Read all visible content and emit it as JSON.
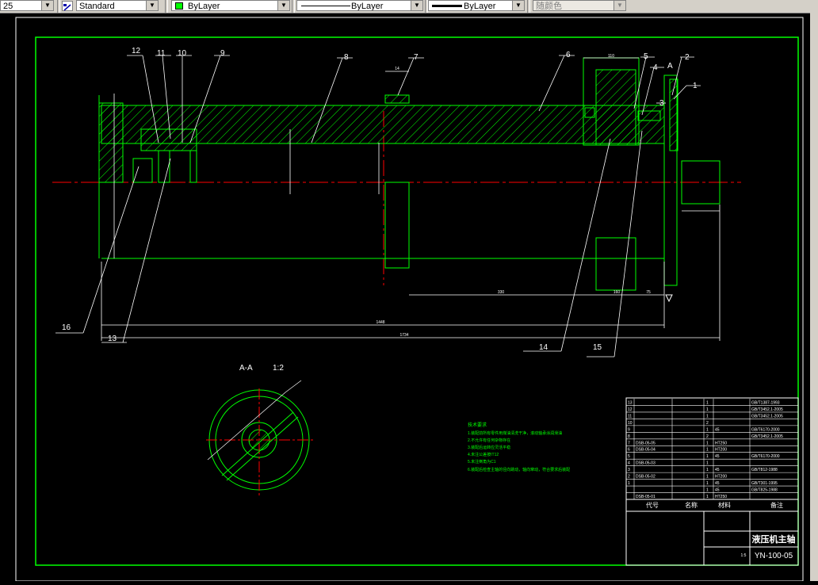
{
  "toolbar": {
    "scale_value": "25",
    "style_icon": "text-style-icon",
    "text_style": "Standard",
    "layer_color": "ByLayer",
    "layer_color_hex": "#00ff00",
    "linetype": "ByLayer",
    "lineweight": "ByLayer",
    "plot_style": "随颜色"
  },
  "drawing": {
    "part_balloons": [
      "1",
      "2",
      "3",
      "4",
      "5",
      "6",
      "7",
      "8",
      "9",
      "10",
      "11",
      "12",
      "13",
      "14",
      "15",
      "16"
    ],
    "section_marker": "A",
    "section_view_label": "A-A",
    "section_view_scale": "1:2",
    "dims": {
      "keyway_width": "14",
      "overall_length": "1734",
      "shaft_length": "1448",
      "right_offset": "75",
      "main_span": "330",
      "short_span": "160",
      "small_span": "110"
    },
    "notes_title": "技术要求",
    "notes": [
      "1.装配前所有零件用煤油清洗干净，滚动轴承涂润滑油",
      "2.不允许有任何杂物存在",
      "3.装配后运转应灵活平稳",
      "4.未注公差按IT12",
      "5.未注倒角为C1",
      "6.装配后检查主轴的径向跳动，轴向窜动，符合要求后装配"
    ]
  },
  "title_block": {
    "bom_rows": [
      {
        "no": "13",
        "code": "",
        "name": "",
        "qty": "1",
        "mat": "",
        "remark": "GB/T1387-1993"
      },
      {
        "no": "12",
        "code": "",
        "name": "",
        "qty": "1",
        "mat": "",
        "remark": "GB/T3452.1-2005"
      },
      {
        "no": "11",
        "code": "",
        "name": "",
        "qty": "1",
        "mat": "",
        "remark": "GB/T3452.1-2005"
      },
      {
        "no": "10",
        "code": "",
        "name": "",
        "qty": "2",
        "mat": "",
        "remark": ""
      },
      {
        "no": "9",
        "code": "",
        "name": "",
        "qty": "1",
        "mat": "45",
        "remark": "GB/T6170-2000"
      },
      {
        "no": "8",
        "code": "",
        "name": "",
        "qty": "2",
        "mat": "",
        "remark": "GB/T3452.1-2005"
      },
      {
        "no": "7",
        "code": "DSB-05-05",
        "name": "",
        "qty": "1",
        "mat": "HT250",
        "remark": ""
      },
      {
        "no": "6",
        "code": "DSB-05-04",
        "name": "",
        "qty": "1",
        "mat": "HT200",
        "remark": ""
      },
      {
        "no": "5",
        "code": "",
        "name": "",
        "qty": "1",
        "mat": "45",
        "remark": "GB/T6170-2000"
      },
      {
        "no": "4",
        "code": "DSB-05-03",
        "name": "",
        "qty": "1",
        "mat": "",
        "remark": ""
      },
      {
        "no": "3",
        "code": "",
        "name": "",
        "qty": "1",
        "mat": "45",
        "remark": "GB/T812-1988"
      },
      {
        "no": "2",
        "code": "DSB-05-02",
        "name": "",
        "qty": "1",
        "mat": "HT200",
        "remark": ""
      },
      {
        "no": "1",
        "code": "",
        "name": "",
        "qty": "1",
        "mat": "45",
        "remark": "GB/T301-1995"
      },
      {
        "no": "",
        "code": "",
        "name": "",
        "qty": "1",
        "mat": "45",
        "remark": "GB/T825-1988"
      },
      {
        "no": "",
        "code": "DSB-05-01",
        "name": "",
        "qty": "1",
        "mat": "HT250",
        "remark": ""
      }
    ],
    "header": {
      "code": "代号",
      "name": "名称",
      "mat": "材料",
      "remark": "备注"
    },
    "school": "",
    "part_title": "液压机主轴",
    "drawing_no": "YN-100-05",
    "scale_label": "1:5"
  },
  "colors": {
    "outline": "#00ff00",
    "dimension": "#ffffff",
    "centerline": "#ff0000",
    "background": "#000000"
  }
}
